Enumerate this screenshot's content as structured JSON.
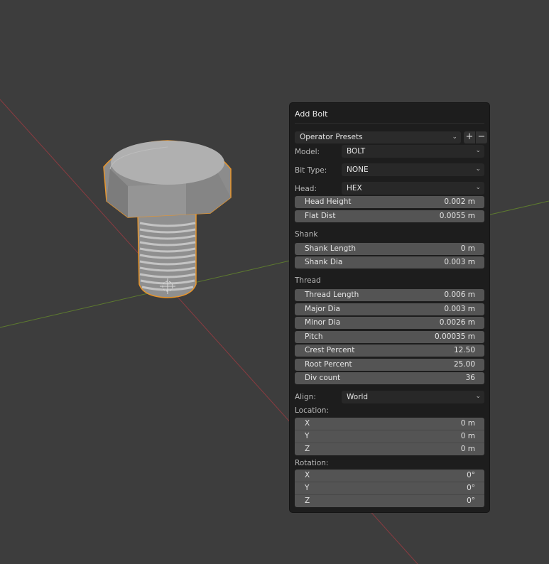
{
  "operator_panel": {
    "title": "Add Bolt",
    "presets": {
      "label": "Operator Presets",
      "add": "+",
      "remove": "−"
    },
    "model": {
      "label": "Model:",
      "value": "BOLT"
    },
    "bit_type": {
      "label": "Bit Type:",
      "value": "NONE"
    },
    "head": {
      "label": "Head:",
      "value": "HEX",
      "fields": [
        {
          "name": "Head Height",
          "value": "0.002 m"
        },
        {
          "name": "Flat Dist",
          "value": "0.0055 m"
        }
      ]
    },
    "shank": {
      "heading": "Shank",
      "fields": [
        {
          "name": "Shank Length",
          "value": "0 m"
        },
        {
          "name": "Shank Dia",
          "value": "0.003 m"
        }
      ]
    },
    "thread": {
      "heading": "Thread",
      "fields": [
        {
          "name": "Thread Length",
          "value": "0.006 m"
        },
        {
          "name": "Major Dia",
          "value": "0.003 m"
        },
        {
          "name": "Minor Dia",
          "value": "0.0026 m"
        },
        {
          "name": "Pitch",
          "value": "0.00035 m"
        },
        {
          "name": "Crest Percent",
          "value": "12.50"
        },
        {
          "name": "Root Percent",
          "value": "25.00"
        },
        {
          "name": "Div count",
          "value": "36"
        }
      ]
    },
    "align": {
      "label": "Align:",
      "value": "World"
    },
    "location": {
      "heading": "Location:",
      "rows": [
        {
          "axis": "X",
          "value": "0 m"
        },
        {
          "axis": "Y",
          "value": "0 m"
        },
        {
          "axis": "Z",
          "value": "0 m"
        }
      ]
    },
    "rotation": {
      "heading": "Rotation:",
      "rows": [
        {
          "axis": "X",
          "value": "0°"
        },
        {
          "axis": "Y",
          "value": "0°"
        },
        {
          "axis": "Z",
          "value": "0°"
        }
      ]
    }
  },
  "colors": {
    "viewport_bg": "#3d3d3d",
    "x_axis_line": "#8a3b40",
    "y_axis_line": "#5d7a2f",
    "selection_outline": "#e8952b",
    "panel_bg": "#1d1d1d",
    "field_bg": "#545454"
  }
}
